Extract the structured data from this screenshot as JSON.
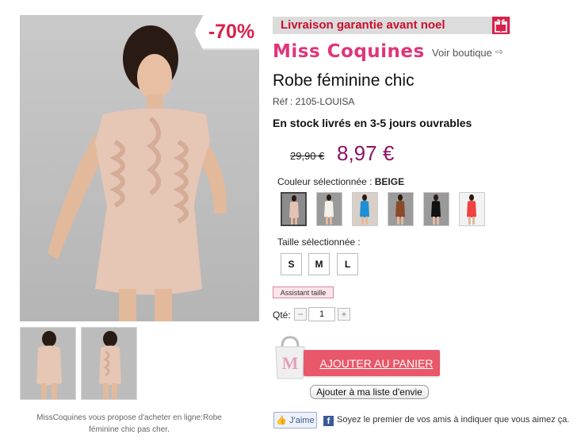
{
  "product": {
    "discount": "-70%",
    "delivery_banner": "Livraison garantie avant noel",
    "brand": "Miss Coquines",
    "voir_boutique": "Voir boutique",
    "title": "Robe féminine chic",
    "ref": "Réf : 2105-LOUISA",
    "stock": "En stock livrés en 3-5 jours ouvrables",
    "old_price": "29,90 €",
    "new_price": "8,97 €",
    "color_label": "Couleur sélectionnée : ",
    "color_selected": "BEIGE",
    "swatches": [
      {
        "color": "#8b8b8b",
        "dress": "#e3c4b4"
      },
      {
        "color": "#9a9a9a",
        "dress": "#f3f1e8"
      },
      {
        "color": "#d8d0c8",
        "dress": "#1e8fd6"
      },
      {
        "color": "#9b9b9b",
        "dress": "#8a4a2a"
      },
      {
        "color": "#9a9a9a",
        "dress": "#111111"
      },
      {
        "color": "#f2f2f2",
        "dress": "#f04040"
      }
    ],
    "size_label": "Taille sélectionnée :",
    "sizes": [
      "S",
      "M",
      "L"
    ],
    "size_assistant": "Assistant taille",
    "qty_label": "Qté:",
    "qty_value": "1",
    "add_to_cart": "AJOUTER AU PANIER",
    "wishlist": "Ajouter à ma liste d'envie",
    "like_label": "J'aime",
    "fb_text": "Soyez le premier de vos amis à indiquer que vous aimez ça.",
    "caption": "MissCoquines vous propose d'acheter en ligne:Robe féminine chic pas cher.",
    "colors": {
      "accent_pink": "#e0357b",
      "price_purple": "#8b1464",
      "cart_button": "#e9576a",
      "banner_red": "#c8102e"
    }
  }
}
